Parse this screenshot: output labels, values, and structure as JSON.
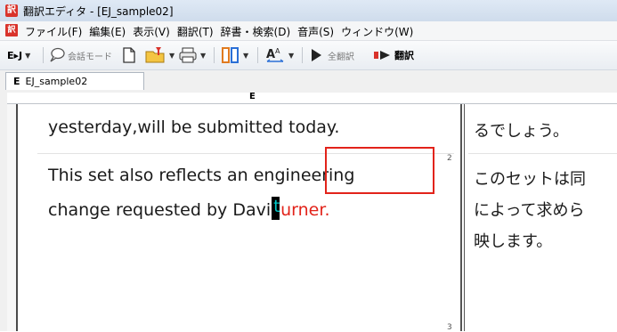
{
  "window": {
    "title": "翻訳エディタ - [EJ_sample02]",
    "app_icon_glyph": "訳",
    "menu_icon_glyph": "訳"
  },
  "menubar": {
    "items": [
      "ファイル(F)",
      "編集(E)",
      "表示(V)",
      "翻訳(T)",
      "辞書・検索(D)",
      "音声(S)",
      "ウィンドウ(W)"
    ]
  },
  "toolbar": {
    "direction_label": "E▸J",
    "conversation_mode_label": "会話モード",
    "translate_all_label": "全翻訳",
    "translate_label": "翻訳"
  },
  "tabs": [
    {
      "label": "EJ_sample02",
      "prefix": "E"
    }
  ],
  "ruler": {
    "label": "E"
  },
  "document": {
    "source_lines": [
      "yesterday,will be submitted today.",
      "This set also reflects an engineering",
      "change requested by Davi",
      "urner."
    ],
    "cursor_char": "t",
    "target_lines": [
      "るでしょう。",
      "このセットは同",
      "によって求めら",
      "映します。"
    ],
    "segment_numbers": [
      "2",
      "3"
    ]
  },
  "colors": {
    "error_red": "#e2231a",
    "cursor_char_color": "#00c7c7"
  }
}
